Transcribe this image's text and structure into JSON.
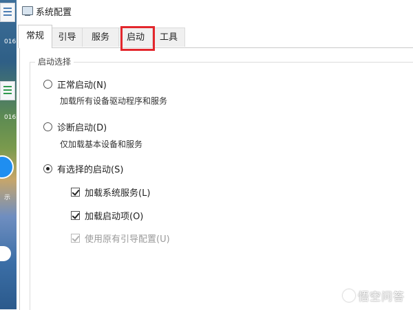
{
  "desktop": {
    "labels": [
      "016",
      "016",
      "示"
    ]
  },
  "window": {
    "title": "系统配置"
  },
  "tabs": [
    {
      "label": "常规",
      "active": true
    },
    {
      "label": "引导",
      "active": false
    },
    {
      "label": "服务",
      "active": false
    },
    {
      "label": "启动",
      "active": false,
      "highlighted": true
    },
    {
      "label": "工具",
      "active": false
    }
  ],
  "startup_group": {
    "legend": "启动选择",
    "normal": {
      "label": "正常启动(N)",
      "desc": "加载所有设备驱动程序和服务",
      "checked": false
    },
    "diagnostic": {
      "label": "诊断启动(D)",
      "desc": "仅加载基本设备和服务",
      "checked": false
    },
    "selective": {
      "label": "有选择的启动(S)",
      "checked": true
    },
    "checkboxes": [
      {
        "label": "加载系统服务(L)",
        "checked": true,
        "disabled": false
      },
      {
        "label": "加载启动项(O)",
        "checked": true,
        "disabled": false
      },
      {
        "label": "使用原有引导配置(U)",
        "checked": true,
        "disabled": true
      }
    ]
  },
  "watermark": {
    "text": "悟空问答"
  },
  "colors": {
    "highlight": "#e3262c"
  }
}
